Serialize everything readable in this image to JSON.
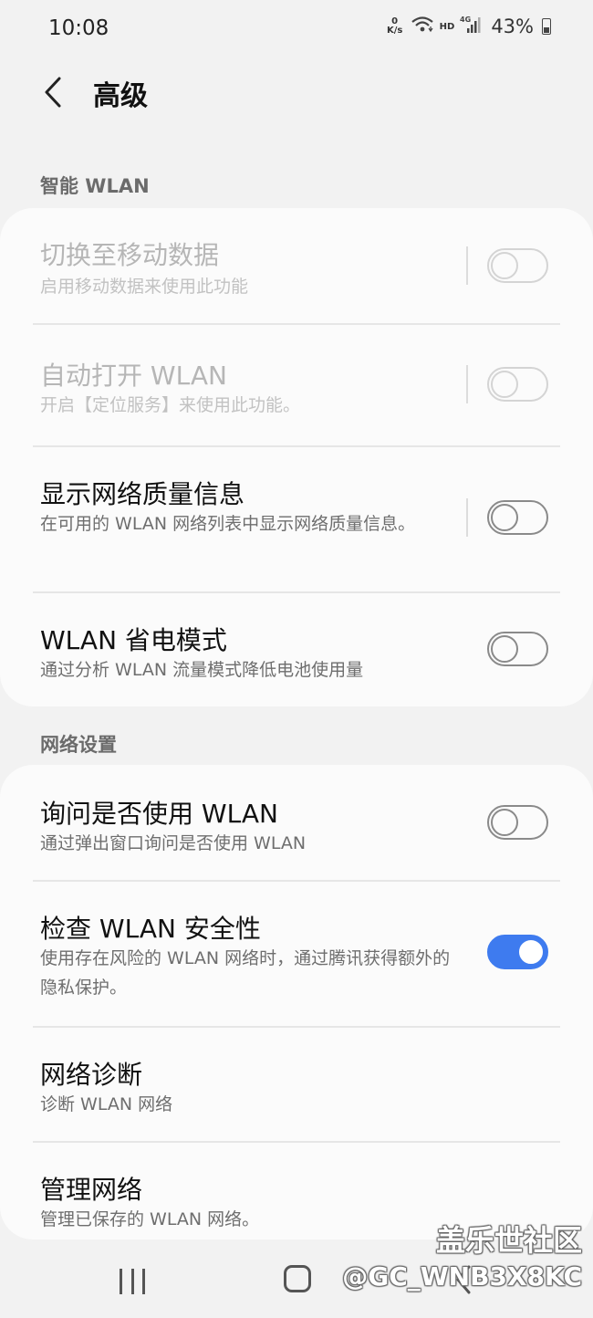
{
  "status_bar": {
    "time": "10:08",
    "net_speed_value": "0",
    "net_speed_unit": "K/s",
    "hd_label": "HD",
    "signal_label": "4G",
    "battery_percent": "43%",
    "icons": [
      "wifi-icon",
      "signal-icon",
      "battery-icon"
    ]
  },
  "header": {
    "title": "高级",
    "back_icon": "chevron-left-icon"
  },
  "sections": {
    "smart_wlan": {
      "label": "智能 WLAN",
      "items": [
        {
          "title": "切换至移动数据",
          "subtitle": "启用移动数据来使用此功能",
          "enabled": false,
          "toggle_on": false
        },
        {
          "title": "自动打开 WLAN",
          "subtitle": "开启【定位服务】来使用此功能。",
          "enabled": false,
          "toggle_on": false
        },
        {
          "title": "显示网络质量信息",
          "subtitle": "在可用的 WLAN 网络列表中显示网络质量信息。",
          "enabled": true,
          "toggle_on": false
        },
        {
          "title": "WLAN 省电模式",
          "subtitle": "通过分析 WLAN 流量模式降低电池使用量",
          "enabled": true,
          "toggle_on": false
        }
      ]
    },
    "network_settings": {
      "label": "网络设置",
      "items": [
        {
          "title": "询问是否使用 WLAN",
          "subtitle": "通过弹出窗口询问是否使用 WLAN",
          "enabled": true,
          "toggle_on": false
        },
        {
          "title": "检查 WLAN 安全性",
          "subtitle": "使用存在风险的 WLAN 网络时，通过腾讯获得额外的隐私保护。",
          "enabled": true,
          "toggle_on": true
        },
        {
          "title": "网络诊断",
          "subtitle": "诊断 WLAN 网络"
        },
        {
          "title": "管理网络",
          "subtitle": "管理已保存的 WLAN 网络。"
        }
      ]
    }
  },
  "nav_bar": {
    "icons": [
      "recent-apps-icon",
      "home-icon",
      "back-icon"
    ]
  },
  "watermark": {
    "line1": "盖乐世社区",
    "line2": "@GC_WNB3X8KC"
  },
  "colors": {
    "accent": "#3e7bef",
    "background": "#f2f2f2",
    "card": "#fbfbfb"
  }
}
